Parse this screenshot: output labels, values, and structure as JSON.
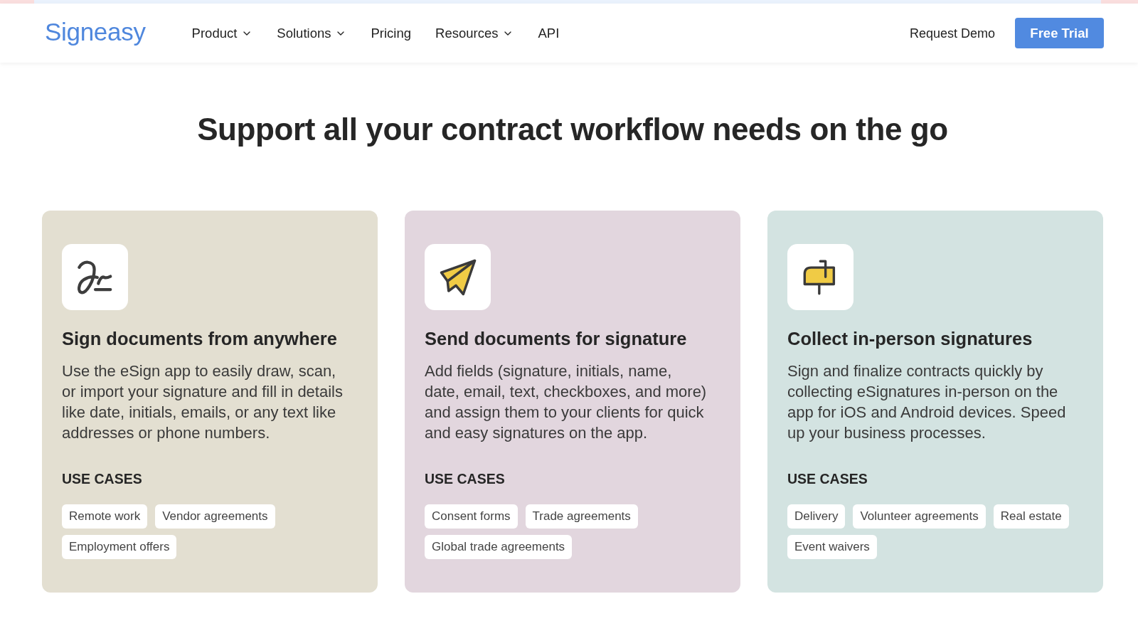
{
  "header": {
    "logo": "Signeasy",
    "nav": [
      {
        "label": "Product",
        "dropdown": true
      },
      {
        "label": "Solutions",
        "dropdown": true
      },
      {
        "label": "Pricing",
        "dropdown": false
      },
      {
        "label": "Resources",
        "dropdown": true
      },
      {
        "label": "API",
        "dropdown": false
      }
    ],
    "request_demo": "Request Demo",
    "cta": "Free Trial"
  },
  "heading": "Support all your contract workflow needs on the go",
  "cards": [
    {
      "title": "Sign documents from anywhere",
      "description": "Use the eSign app to easily draw, scan, or import your signature and fill in details like date, initials, emails, or any text like addresses or phone numbers.",
      "use_cases_label": "USE CASES",
      "use_cases": [
        "Remote work",
        "Vendor agreements",
        "Employment offers"
      ],
      "color": "#e3dfd1"
    },
    {
      "title": "Send documents for signature",
      "description": "Add fields (signature, initials, name, date, email, text, checkboxes, and more) and assign them to your clients for quick and easy signatures on the app.",
      "use_cases_label": "USE CASES",
      "use_cases": [
        "Consent forms",
        "Trade agreements",
        "Global trade agreements"
      ],
      "color": "#e2d6de"
    },
    {
      "title": "Collect in-person signatures",
      "description": "Sign and finalize contracts quickly by collecting eSignatures in-person on the app for iOS and Android devices. Speed up your business processes.",
      "use_cases_label": "USE CASES",
      "use_cases": [
        "Delivery",
        "Volunteer agreements",
        "Real estate",
        "Event waivers"
      ],
      "color": "#d3e3e1"
    }
  ]
}
